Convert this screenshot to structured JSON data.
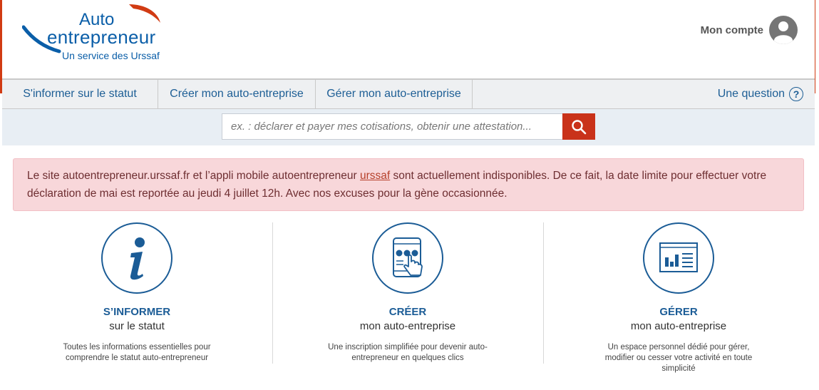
{
  "logo": {
    "line1": "Auto",
    "line2": "entrepreneur",
    "tagline": "Un service des Urssaf"
  },
  "account": {
    "label": "Mon compte",
    "icon": "user-avatar-icon"
  },
  "nav": {
    "items": [
      {
        "label": "S'informer sur le statut"
      },
      {
        "label": "Créer mon auto-entreprise"
      },
      {
        "label": "Gérer mon auto-entreprise"
      }
    ],
    "question_label": "Une question",
    "question_icon": "?"
  },
  "search": {
    "placeholder": "ex. : déclarer et payer mes cotisations, obtenir une attestation...",
    "button_icon": "search-icon"
  },
  "alert": {
    "part1": "Le site autoentrepreneur.urssaf.fr et l’appli mobile autoentrepreneur ",
    "link": "urssaf",
    "part2": " sont actuellement indisponibles. De ce fait, la date limite pour effectuer votre déclaration de mai est reportée au jeudi 4 juillet 12h. Avec nos excuses pour la gène occasionnée."
  },
  "columns": [
    {
      "title": "S’INFORMER",
      "subtitle": "sur le statut",
      "description": "Toutes les informations essentielles pour comprendre le statut auto-entrepreneur",
      "icon": "info-icon"
    },
    {
      "title": "CRÉER",
      "subtitle": "mon auto-entreprise",
      "description": "Une inscription simplifiée pour devenir auto-entrepreneur en quelques clics",
      "icon": "tablet-tap-icon"
    },
    {
      "title": "GÉRER",
      "subtitle": "mon auto-entreprise",
      "description": "Un espace personnel dédié pour gérer, modifier ou cesser votre activité en toute simplicité",
      "icon": "dashboard-chart-icon"
    }
  ],
  "colors": {
    "brand_blue": "#0a5ea8",
    "accent_red": "#c9321a",
    "alert_bg": "#f8d7da"
  }
}
